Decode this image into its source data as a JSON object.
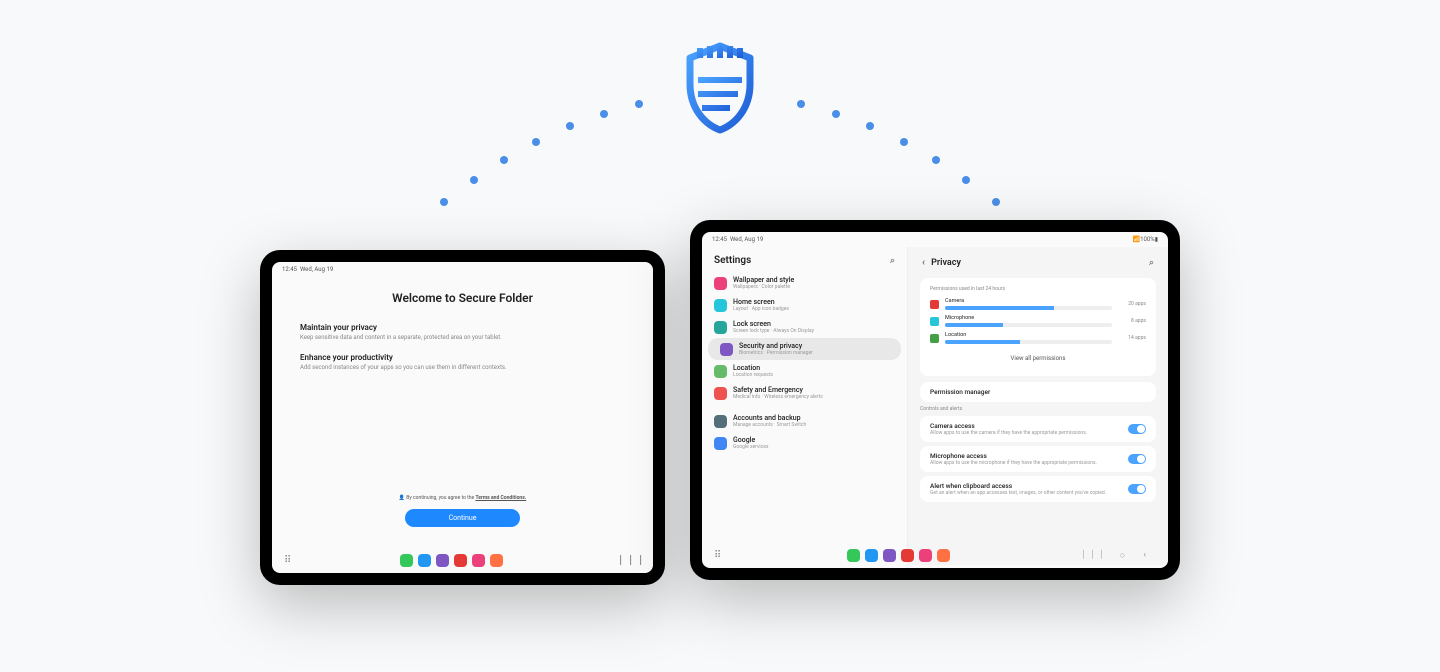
{
  "clock": "12:45",
  "date": "Wed, Aug 19",
  "secure_folder": {
    "title": "Welcome to Secure Folder",
    "sections": [
      {
        "h": "Maintain your privacy",
        "s": "Keep sensitive data and content in a separate, protected area on your tablet."
      },
      {
        "h": "Enhance your productivity",
        "s": "Add second instances of your apps so you can use them in different contexts."
      }
    ],
    "terms_prefix": "By continuing, you agree to the ",
    "terms_link": "Terms and Conditions.",
    "continue": "Continue"
  },
  "settings_title": "Settings",
  "privacy_title": "Privacy",
  "perm_used_label": "Permissions used in last 24 hours",
  "view_all": "View all permissions",
  "perm_manager": "Permission manager",
  "controls_label": "Controls and alerts",
  "nav_items": [
    {
      "t": "Wallpaper and style",
      "s": "Wallpapers · Color palette",
      "c": "#ec407a"
    },
    {
      "t": "Home screen",
      "s": "Layout · App icon badges",
      "c": "#26c6da"
    },
    {
      "t": "Lock screen",
      "s": "Screen lock type · Always On Display",
      "c": "#26a69a"
    },
    {
      "t": "Security and privacy",
      "s": "Biometrics · Permission manager",
      "c": "#7e57c2",
      "active": true
    },
    {
      "t": "Location",
      "s": "Location requests",
      "c": "#66bb6a"
    },
    {
      "t": "Safety and Emergency",
      "s": "Medical info · Wireless emergency alerts",
      "c": "#ef5350"
    },
    {
      "t": "Accounts and backup",
      "s": "Manage accounts · Smart Switch",
      "c": "#546e7a"
    },
    {
      "t": "Google",
      "s": "Google services",
      "c": "#4285f4"
    }
  ],
  "perm_rows": [
    {
      "name": "Camera",
      "fill": 65,
      "count": "20 apps",
      "c": "#e53935"
    },
    {
      "name": "Microphone",
      "fill": 35,
      "count": "8 apps",
      "c": "#26c6da"
    },
    {
      "name": "Location",
      "fill": 45,
      "count": "14 apps",
      "c": "#43a047"
    }
  ],
  "toggles": [
    {
      "t": "Camera access",
      "s": "Allow apps to use the camera if they have the appropriate permissions."
    },
    {
      "t": "Microphone access",
      "s": "Allow apps to use the microphone if they have the appropriate permissions."
    },
    {
      "t": "Alert when clipboard access",
      "s": "Get an alert when an app accesses text, images, or other content you've copied."
    }
  ],
  "status_right": "100%"
}
